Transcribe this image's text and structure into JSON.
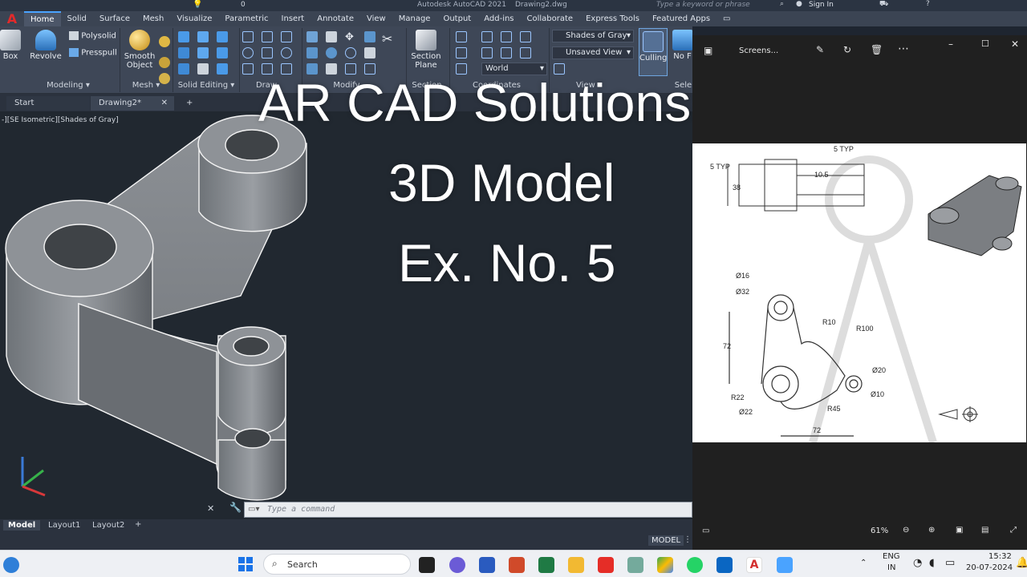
{
  "window": {
    "app_title": "Autodesk AutoCAD 2021",
    "file_title": "Drawing2.dwg",
    "search_placeholder": "Type a keyword or phrase",
    "sign_in": "Sign In",
    "qat_value": "0"
  },
  "ribbon": {
    "tabs": [
      "Home",
      "Solid",
      "Surface",
      "Mesh",
      "Visualize",
      "Parametric",
      "Insert",
      "Annotate",
      "View",
      "Manage",
      "Output",
      "Add-ins",
      "Collaborate",
      "Express Tools",
      "Featured Apps"
    ],
    "active_tab": "Home",
    "buttons": {
      "box": "Box",
      "revolve": "Revolve",
      "polysolid": "Polysolid",
      "presspull": "Presspull",
      "smooth_object_1": "Smooth",
      "smooth_object_2": "Object",
      "section_plane_1": "Section",
      "section_plane_2": "Plane",
      "culling": "Culling",
      "no_filter": "No F"
    },
    "dropdowns": {
      "visual_style": "Shades of Gray",
      "view": "Unsaved View",
      "coordinates": "World"
    },
    "panels": [
      "Modeling",
      "Mesh",
      "Solid Editing",
      "Draw",
      "Modify",
      "Section",
      "Coordinates",
      "View",
      "Sele"
    ]
  },
  "doc_tabs": {
    "start": "Start",
    "active": "Drawing2*"
  },
  "viewport": {
    "label": "-][SE Isometric][Shades of Gray]"
  },
  "overlay": {
    "line1": "AR CAD Solutions..",
    "line2": "3D Model",
    "line3": "Ex. No. 5"
  },
  "command_line": {
    "placeholder": "Type a command"
  },
  "layout_tabs": [
    "Model",
    "Layout1",
    "Layout2"
  ],
  "status": {
    "model": "MODEL"
  },
  "viewer": {
    "title": "Screens...",
    "zoom": "61%",
    "drawing": {
      "dims": [
        "5 TYP",
        "5 TYP",
        "10.5",
        "38",
        "Ø16",
        "Ø32",
        "R10",
        "R100",
        "72",
        "Ø20",
        "Ø10",
        "R22",
        "Ø22",
        "R45",
        "72"
      ]
    }
  },
  "taskbar": {
    "search": "Search",
    "lang_1": "ENG",
    "lang_2": "IN",
    "time": "15:32",
    "date": "20-07-2024"
  },
  "colors": {
    "accent": "#4aa3ff",
    "app_red": "#e32a2a",
    "viewport_bg": "#212830"
  }
}
